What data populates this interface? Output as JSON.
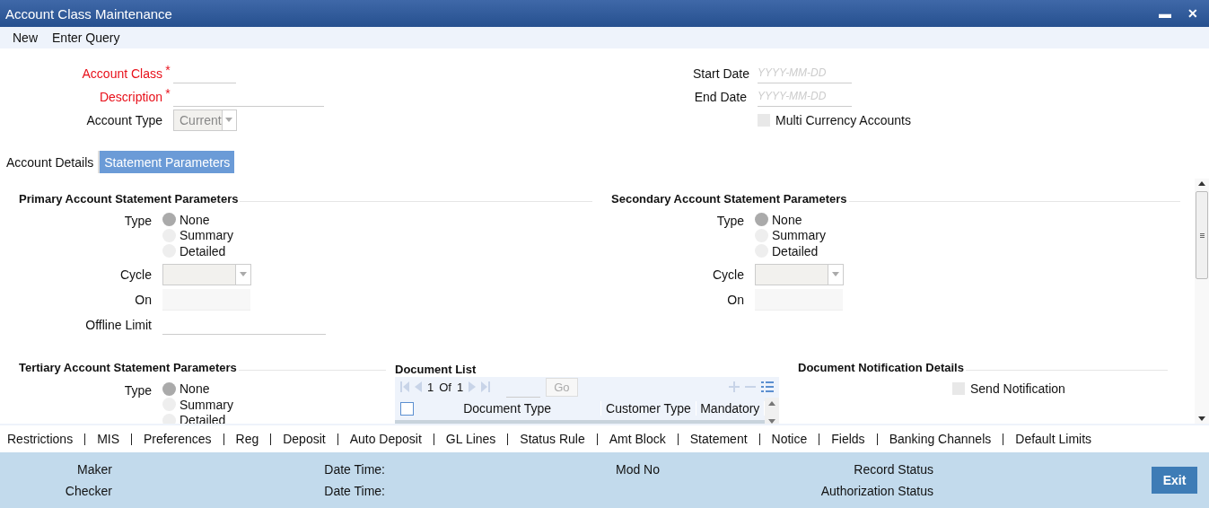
{
  "window": {
    "title": "Account Class Maintenance",
    "controls": [
      "▬",
      "✕"
    ]
  },
  "toolbar": [
    "New",
    "Enter Query"
  ],
  "header_left": [
    {
      "label": "Account Class",
      "required": true,
      "star": "*",
      "kind": "code"
    },
    {
      "label": "Description",
      "required": true,
      "star": "*",
      "kind": "text"
    },
    {
      "label": "Account Type",
      "required": false,
      "kind": "select",
      "value": "Current"
    }
  ],
  "header_right": [
    {
      "label": "Start Date",
      "kind": "date",
      "placeholder": "YYYY-MM-DD"
    },
    {
      "label": "End Date",
      "kind": "date",
      "placeholder": "YYYY-MM-DD"
    },
    {
      "label": "Multi Currency Accounts",
      "kind": "checkbox",
      "checked": false
    }
  ],
  "tabs": [
    {
      "label": "Account Details",
      "selected": false
    },
    {
      "label": "Statement Parameters",
      "selected": true
    }
  ],
  "primary": {
    "title": "Primary Account Statement Parameters",
    "type_label": "Type",
    "options": [
      {
        "label": "None",
        "selected": true
      },
      {
        "label": "Summary",
        "selected": false
      },
      {
        "label": "Detailed",
        "selected": false
      }
    ],
    "cycle_label": "Cycle",
    "on_label": "On",
    "offline_label": "Offline Limit"
  },
  "secondary": {
    "title": "Secondary Account Statement Parameters",
    "type_label": "Type",
    "options": [
      {
        "label": "None",
        "selected": true
      },
      {
        "label": "Summary",
        "selected": false
      },
      {
        "label": "Detailed",
        "selected": false
      }
    ],
    "cycle_label": "Cycle",
    "on_label": "On"
  },
  "tertiary": {
    "title": "Tertiary Account Statement Parameters",
    "type_label": "Type",
    "options": [
      {
        "label": "None",
        "selected": true
      },
      {
        "label": "Summary",
        "selected": false
      },
      {
        "label": "Detailed",
        "selected": false
      }
    ]
  },
  "document_list": {
    "title": "Document List",
    "page": "1",
    "of": "Of",
    "total": "1",
    "go": "Go",
    "columns": [
      "Document Type",
      "Customer Type",
      "Mandatory"
    ],
    "select_all_checked": false
  },
  "notification": {
    "title": "Document Notification Details",
    "send_label": "Send Notification",
    "send_checked": false
  },
  "bottom_links": [
    "Restrictions",
    "MIS",
    "Preferences",
    "Reg",
    "Deposit",
    "Auto Deposit",
    "GL Lines",
    "Status Rule",
    "Amt Block",
    "Statement",
    "Notice",
    "Fields",
    "Banking Channels",
    "Default Limits"
  ],
  "footer": {
    "rows": [
      [
        "Maker",
        "Date Time:",
        "Mod No",
        "Record Status"
      ],
      [
        "Checker",
        "Date Time:",
        "",
        "Authorization Status"
      ]
    ],
    "exit": "Exit"
  }
}
